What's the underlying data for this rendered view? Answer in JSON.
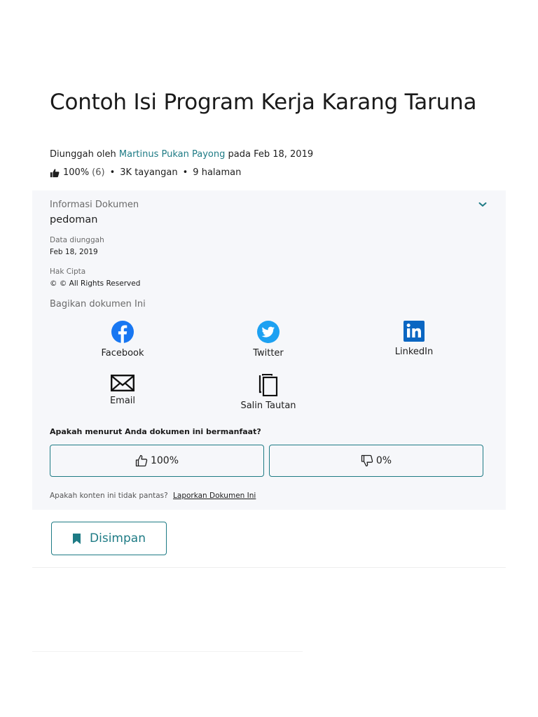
{
  "document": {
    "title": "Contoh Isi Program Kerja Karang Taruna",
    "uploaded_by_prefix": "Diunggah oleh",
    "author": "Martinus Pukan Payong",
    "uploaded_on_prefix": "pada",
    "upload_date": "Feb 18, 2019",
    "rating": "100%",
    "rating_count": "(6)",
    "views": "3K tayangan",
    "pages": "9 halaman"
  },
  "info": {
    "label": "Informasi Dokumen",
    "category": "pedoman",
    "upload_date_label": "Data diunggah",
    "upload_date_value": "Feb 18, 2019",
    "copyright_label": "Hak Cipta",
    "copyright_value": "© © All Rights Reserved"
  },
  "share": {
    "label": "Bagikan dokumen Ini",
    "facebook": "Facebook",
    "twitter": "Twitter",
    "linkedin": "LinkedIn",
    "email": "Email",
    "copy_link": "Salin Tautan"
  },
  "feedback": {
    "question": "Apakah menurut Anda dokumen ini bermanfaat?",
    "upvote": "100%",
    "downvote": "0%",
    "report_prompt": "Apakah konten ini tidak pantas?",
    "report_link": "Laporkan Dokumen Ini"
  },
  "save": {
    "label": "Disimpan"
  },
  "colors": {
    "accent": "#1e7b85",
    "facebook": "#1877f2",
    "twitter": "#1da1f2",
    "linkedin": "#0a66c2",
    "panel": "#f6f7fa"
  }
}
